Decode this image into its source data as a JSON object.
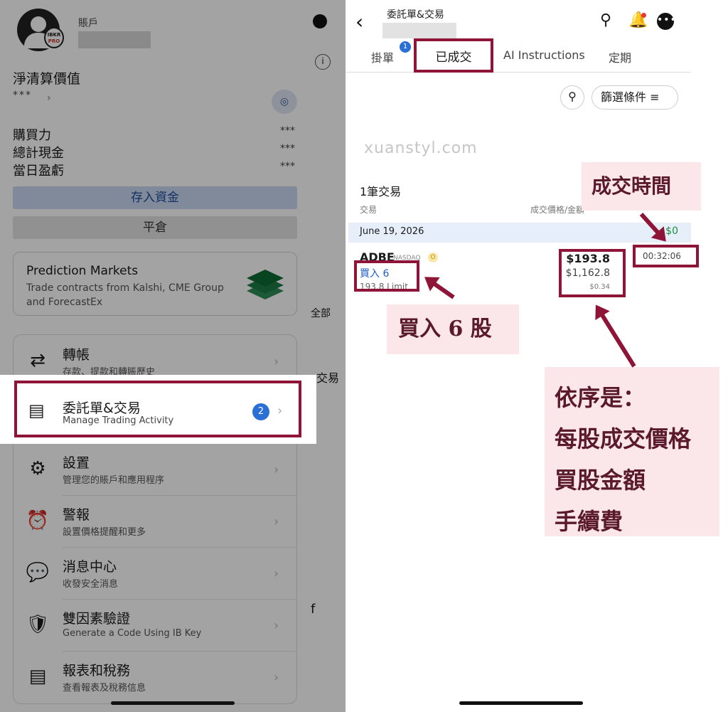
{
  "left": {
    "account_label": "賬戶",
    "net_liq_label": "淨清算價值",
    "masked": "***",
    "buying_power": "購買力",
    "total_cash": "總計現金",
    "daily_pnl": "當日盈虧",
    "deposit_button": "存入資金",
    "close_button": "平倉",
    "promo": {
      "title": "Prediction Markets",
      "desc": "Trade contracts from Kalshi, CME Group and ForecastEx"
    },
    "menu": [
      {
        "title": "轉帳",
        "sub": "存款、提款和轉賬歷史",
        "icon": "transfer-icon"
      },
      {
        "title": "委託單&交易",
        "sub": "Manage Trading Activity",
        "badge": "2",
        "icon": "orders-icon"
      },
      {
        "title": "設置",
        "sub": "管理您的賬戶和應用程序",
        "icon": "settings-icon"
      },
      {
        "title": "警報",
        "sub": "設置價格提醒和更多",
        "icon": "alarm-icon"
      },
      {
        "title": "消息中心",
        "sub": "收發安全消息",
        "icon": "message-icon"
      },
      {
        "title": "雙因素驗證",
        "sub": "Generate a Code Using IB Key",
        "icon": "shield-icon"
      },
      {
        "title": "報表和稅務",
        "sub": "查看報表及稅務信息",
        "icon": "report-icon"
      }
    ],
    "peek_labels": [
      "全部",
      "交易",
      "f"
    ]
  },
  "right": {
    "title": "委託單&交易",
    "tabs": [
      "掛單",
      "已成交",
      "AI Instructions",
      "定期"
    ],
    "tab_badge": "1",
    "filter_label": "篩選條件",
    "watermark": "xuanstyl.com",
    "trade_count": "1筆交易",
    "col_trade": "交易",
    "col_price": "成交價格/金額",
    "date": "June 19, 2026",
    "date_total": "$0",
    "trade": {
      "symbol": "ADBE",
      "exchange": "NASDAQ",
      "badge": "O",
      "side_qty": "買入 6",
      "order": "193.8 Limit",
      "price": "$193.8",
      "amount": "$1,162.8",
      "fee": "$0.34",
      "time": "00:32:06"
    }
  },
  "annotations": {
    "time_note": "成交時間",
    "buy_note": "買入 6 股",
    "order_note": [
      "依序是：",
      "每股成交價格",
      "買股金額",
      "手續費"
    ]
  },
  "colors": {
    "highlight": "#8e1538",
    "note_bg": "#fbe7ea",
    "link": "#1e5cc9"
  }
}
